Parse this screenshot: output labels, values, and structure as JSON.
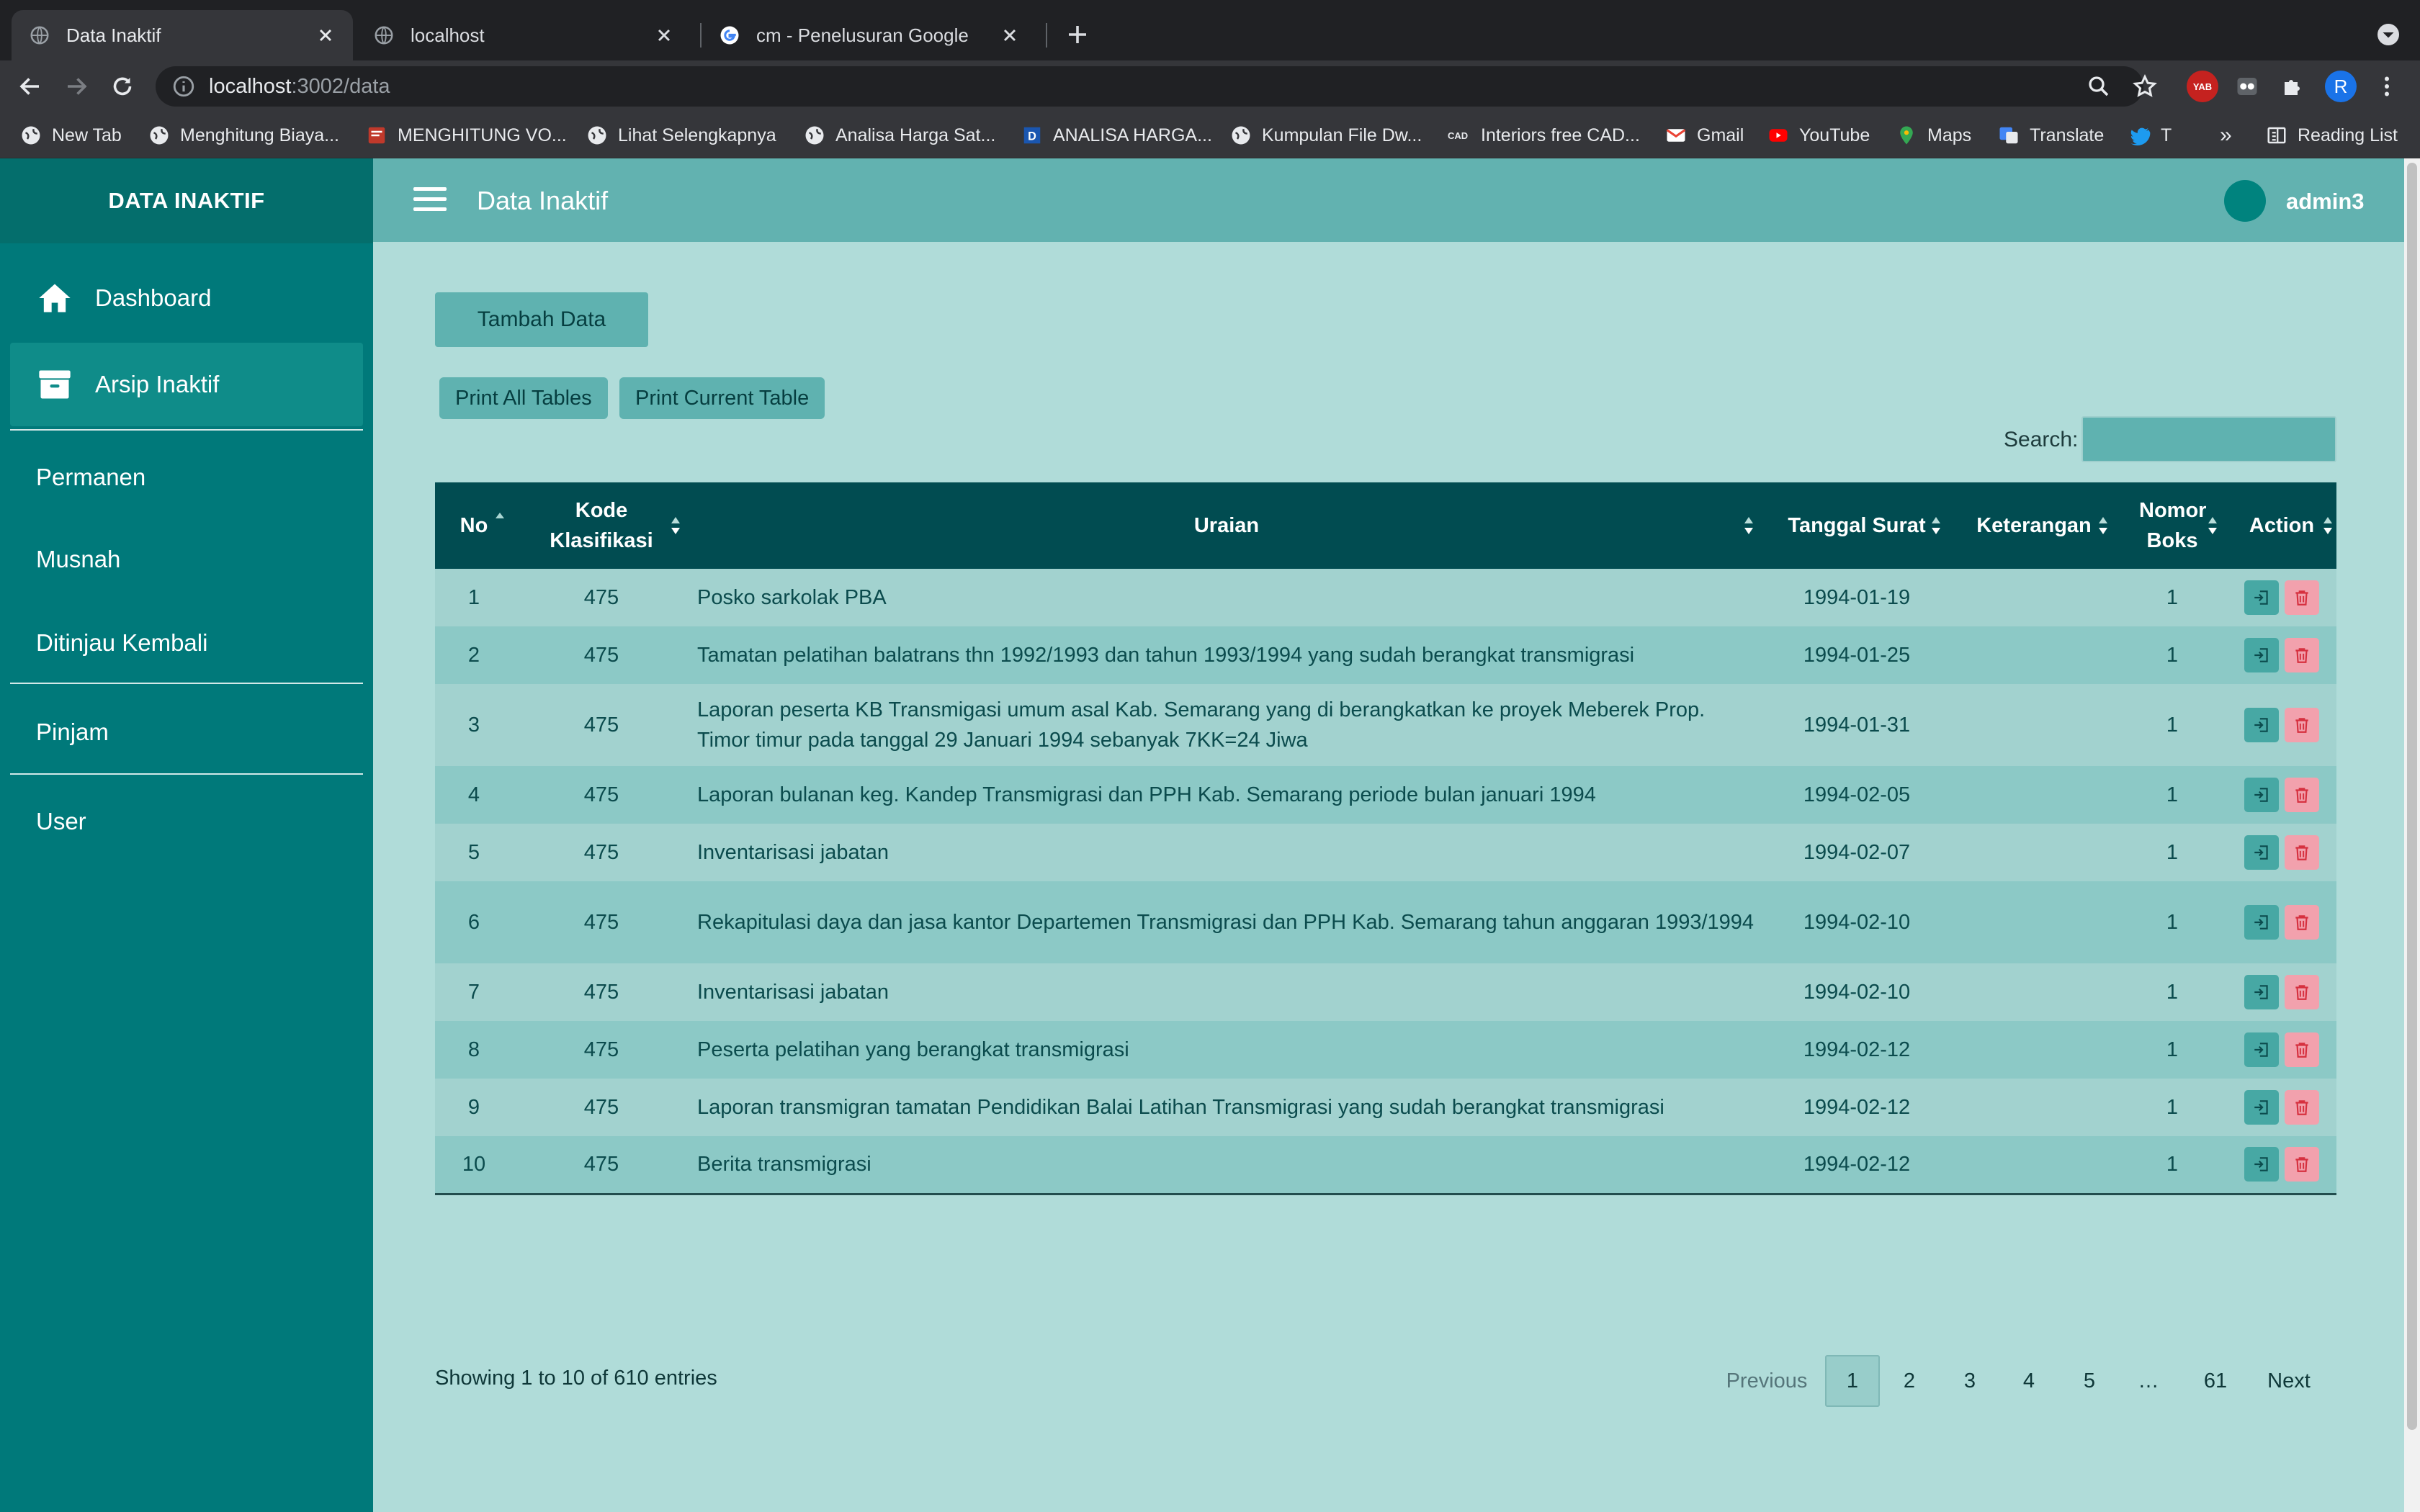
{
  "browser": {
    "tabs": [
      {
        "title": "Data Inaktif",
        "active": true
      },
      {
        "title": "localhost",
        "active": false
      },
      {
        "title": "cm - Penelusuran Google",
        "active": false
      }
    ],
    "url_host": "localhost",
    "url_path": ":3002/data",
    "bookmarks": [
      "New Tab",
      "Menghitung Biaya...",
      "MENGHITUNG VO...",
      "Lihat Selengkapnya",
      "Analisa Harga Sat...",
      "ANALISA HARGA...",
      "Kumpulan File Dw...",
      "Interiors free CAD...",
      "Gmail",
      "YouTube",
      "Maps",
      "Translate",
      "T"
    ],
    "bookmarks_more": "»",
    "reading_list": "Reading List",
    "profile_initial": "R",
    "badge_ext": "YAB",
    "badge_cad": "CAD"
  },
  "app": {
    "brand": "DATA INAKTIF",
    "page_title": "Data Inaktif",
    "username": "admin3",
    "sidebar": {
      "dashboard": "Dashboard",
      "arsip": "Arsip Inaktif",
      "permanen": "Permanen",
      "musnah": "Musnah",
      "ditinjau": "Ditinjau Kembali",
      "pinjam": "Pinjam",
      "user": "User"
    },
    "colors": {
      "sidebar": "#00797a",
      "topbar": "#62b2b0",
      "content_bg": "#b0dcd9",
      "table_header": "#014c51"
    }
  },
  "toolbar": {
    "add": "Tambah Data",
    "print_all": "Print All Tables",
    "print_current": "Print Current Table",
    "search_label": "Search:"
  },
  "table": {
    "columns": [
      "No",
      "Kode Klasifikasi",
      "Uraian",
      "Tanggal Surat",
      "Keterangan",
      "Nomor Boks",
      "Action"
    ],
    "rows": [
      {
        "no": "1",
        "kode": "475",
        "uraian": "Posko sarkolak PBA",
        "tanggal": "1994-01-19",
        "keterangan": "",
        "boks": "1"
      },
      {
        "no": "2",
        "kode": "475",
        "uraian": "Tamatan pelatihan balatrans thn 1992/1993 dan tahun 1993/1994 yang sudah berangkat transmigrasi",
        "tanggal": "1994-01-25",
        "keterangan": "",
        "boks": "1"
      },
      {
        "no": "3",
        "kode": "475",
        "uraian": "Laporan peserta KB Transmigasi umum asal Kab. Semarang yang di berangkatkan ke proyek Meberek Prop. Timor timur pada tanggal 29 Januari 1994 sebanyak 7KK=24 Jiwa",
        "tanggal": "1994-01-31",
        "keterangan": "",
        "boks": "1"
      },
      {
        "no": "4",
        "kode": "475",
        "uraian": "Laporan bulanan keg. Kandep Transmigrasi dan PPH Kab. Semarang periode bulan januari 1994",
        "tanggal": "1994-02-05",
        "keterangan": "",
        "boks": "1"
      },
      {
        "no": "5",
        "kode": "475",
        "uraian": "Inventarisasi jabatan",
        "tanggal": "1994-02-07",
        "keterangan": "",
        "boks": "1"
      },
      {
        "no": "6",
        "kode": "475",
        "uraian": "Rekapitulasi daya dan jasa kantor Departemen Transmigrasi dan PPH Kab. Semarang tahun anggaran 1993/1994",
        "tanggal": "1994-02-10",
        "keterangan": "",
        "boks": "1"
      },
      {
        "no": "7",
        "kode": "475",
        "uraian": "Inventarisasi jabatan",
        "tanggal": "1994-02-10",
        "keterangan": "",
        "boks": "1"
      },
      {
        "no": "8",
        "kode": "475",
        "uraian": "Peserta pelatihan yang berangkat transmigrasi",
        "tanggal": "1994-02-12",
        "keterangan": "",
        "boks": "1"
      },
      {
        "no": "9",
        "kode": "475",
        "uraian": "Laporan transmigran tamatan Pendidikan Balai Latihan Transmigrasi yang sudah berangkat transmigrasi",
        "tanggal": "1994-02-12",
        "keterangan": "",
        "boks": "1"
      },
      {
        "no": "10",
        "kode": "475",
        "uraian": "Berita transmigrasi",
        "tanggal": "1994-02-12",
        "keterangan": "",
        "boks": "1"
      }
    ],
    "info": "Showing 1 to 10 of 610 entries"
  },
  "pagination": {
    "previous": "Previous",
    "pages": [
      "1",
      "2",
      "3",
      "4",
      "5",
      "…",
      "61"
    ],
    "current": "1",
    "next": "Next"
  }
}
